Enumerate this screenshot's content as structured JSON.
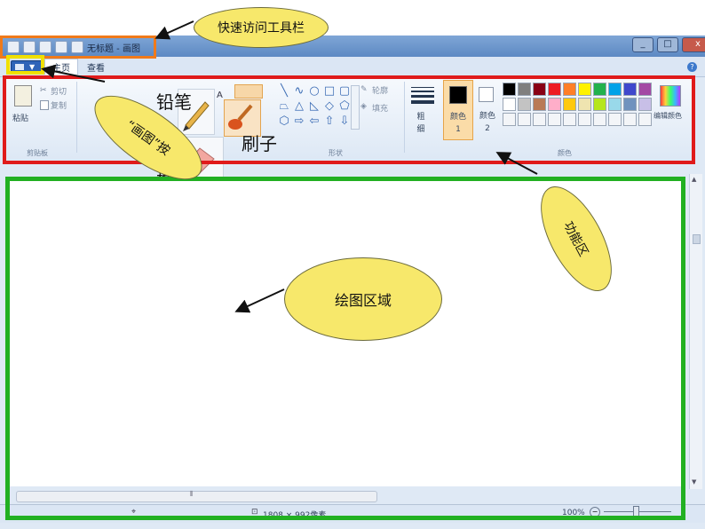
{
  "window": {
    "title": "无标题 - 画图",
    "controls": [
      "_",
      "□",
      "x"
    ]
  },
  "tabs": [
    {
      "label": "主页",
      "active": true
    },
    {
      "label": "查看",
      "active": false
    }
  ],
  "ribbon": {
    "clipboard": {
      "paste_label": "粘贴",
      "cut_label": "剪切",
      "copy_label": "复制",
      "group_label": "剪贴板"
    },
    "shapes": {
      "outline_label": "轮廓",
      "fill_label": "填充",
      "group_label": "形状"
    },
    "size_label": "粗细",
    "color1_label": "颜色 1",
    "color2_label": "颜色 2",
    "colors_group_label": "颜色",
    "edit_colors_label": "编辑颜色"
  },
  "palette_colors": [
    "#000000",
    "#7f7f7f",
    "#880015",
    "#ed1c24",
    "#ff7f27",
    "#fff200",
    "#22b14c",
    "#00a2e8",
    "#3f48cc",
    "#a349a4",
    "#ffffff",
    "#c3c3c3",
    "#b97a57",
    "#ffaec9",
    "#ffc90e",
    "#efe4b0",
    "#b5e61d",
    "#99d9ea",
    "#7092be",
    "#c8bfe7"
  ],
  "status": {
    "dimensions": "1808 × 992像素",
    "zoom": "100%"
  },
  "popup": {
    "pencil_label": "铅笔",
    "brush_label": "刷子",
    "eraser_label": "橡皮"
  },
  "callouts": {
    "quick_access": "快速访问工具栏",
    "paint_button": "“画图”按",
    "ribbon": "功能区",
    "canvas": "绘图区域"
  },
  "frame_colors": {
    "quick_access": "#f07a1a",
    "paint_button": "#f0e000",
    "ribbon": "#e01a1a",
    "canvas": "#22b022"
  }
}
